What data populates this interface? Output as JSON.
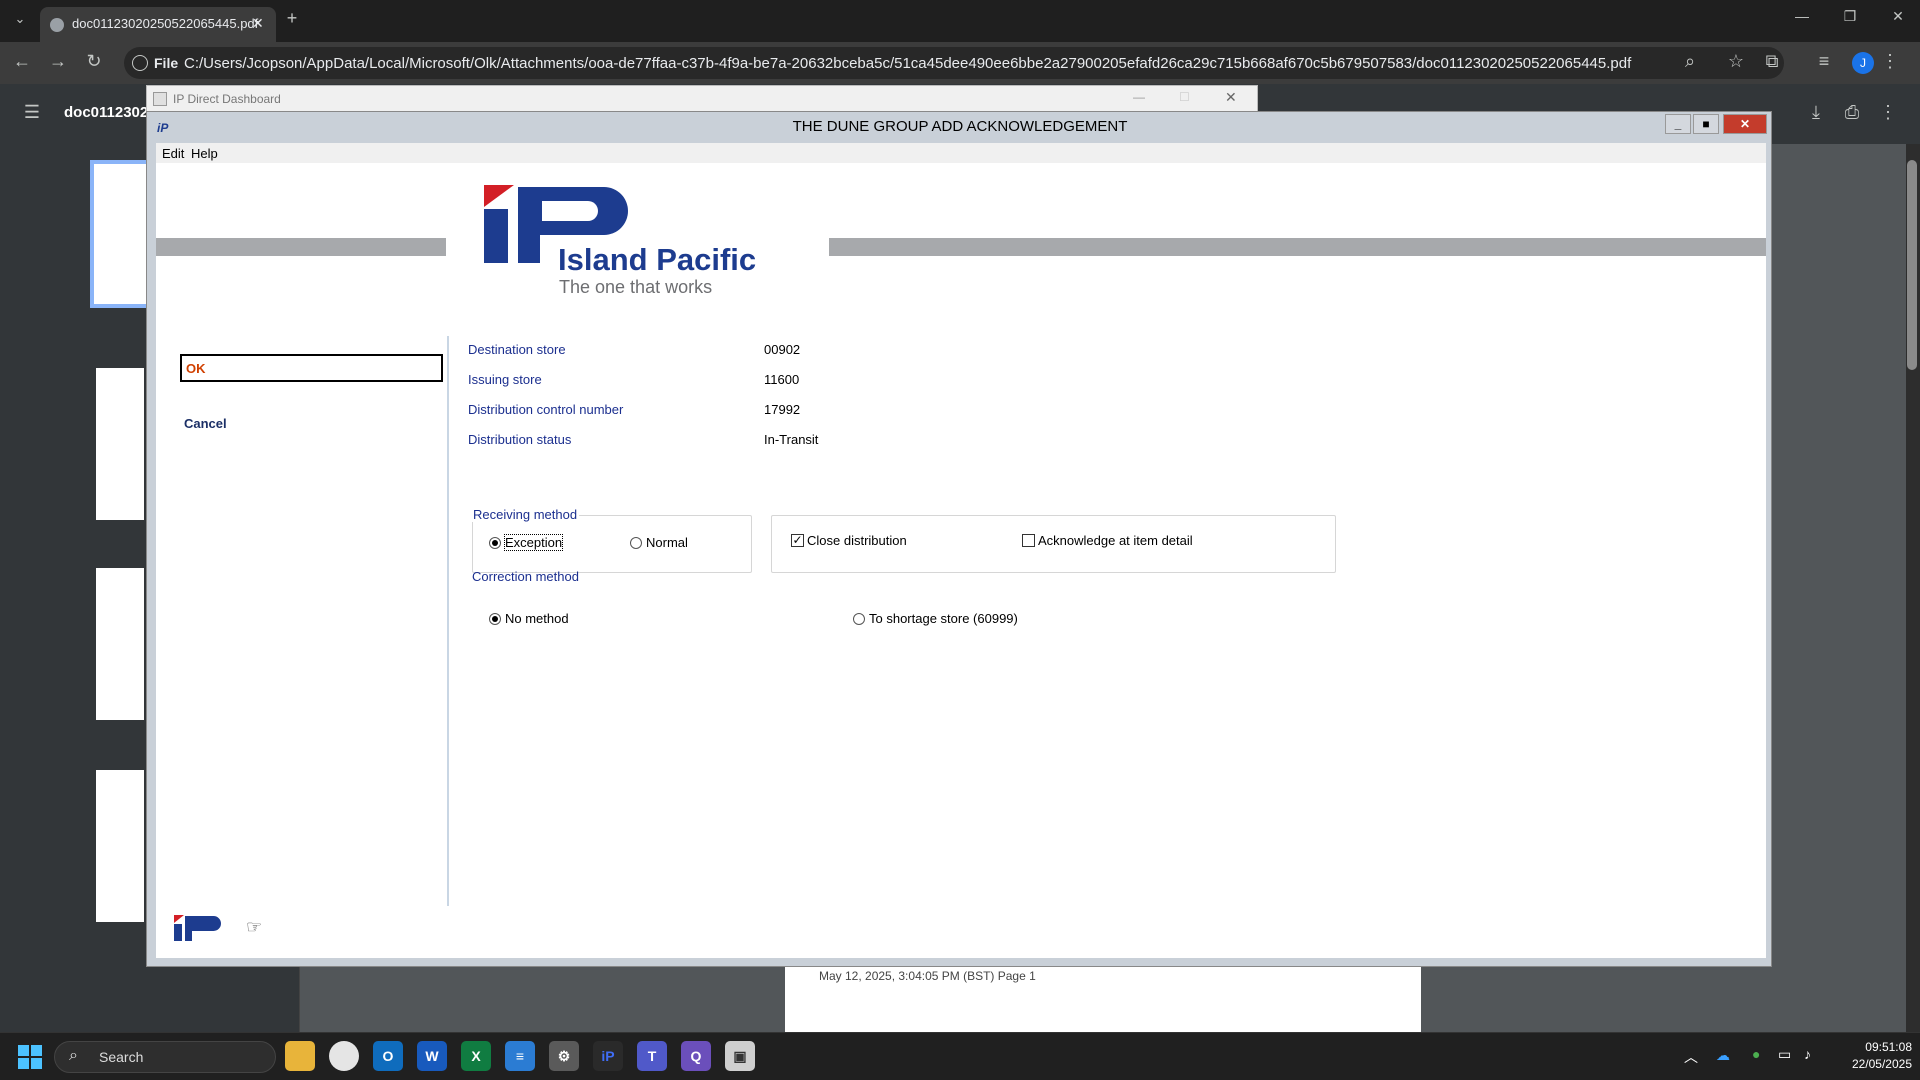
{
  "browser": {
    "tab_title": "doc01123020250522065445.pdf",
    "chip": "File",
    "url": "C:/Users/Jcopson/AppData/Local/Microsoft/Olk/Attachments/ooa-de77ffaa-c37b-4f9a-be7a-20632bceba5c/51ca45dee490ee6bbe2a27900205efafd26ca29c715b668af670c5b679507583/doc01123020250522065445.pdf",
    "profile_initial": "J"
  },
  "pdf": {
    "title": "doc01123020",
    "page_footer": "May 12, 2025, 3:04:05 PM (BST) Page 1"
  },
  "back_window": {
    "title": "IP Direct Dashboard"
  },
  "dialog": {
    "title": "THE DUNE GROUP    ADD ACKNOWLEDGEMENT",
    "menu": [
      "Edit",
      "Help"
    ],
    "logo": {
      "brand": "Island Pacific",
      "tagline": "The one that works",
      "mark": "iP"
    },
    "actions": {
      "ok": "OK",
      "cancel": "Cancel"
    },
    "fields": [
      {
        "label": "Destination store",
        "value": "00902"
      },
      {
        "label": "Issuing store",
        "value": "11600"
      },
      {
        "label": "Distribution control number",
        "value": "17992"
      },
      {
        "label": "Distribution status",
        "value": "In-Transit"
      }
    ],
    "receiving_method": {
      "title": "Receiving method",
      "options": [
        "Exception",
        "Normal"
      ],
      "selected": "Exception"
    },
    "distribution_options": {
      "close_distribution": {
        "label": "Close distribution",
        "checked": true
      },
      "acknowledge_item_detail": {
        "label": "Acknowledge at item detail",
        "checked": false
      }
    },
    "correction_method": {
      "title": "Correction method",
      "options": [
        "No method",
        "To shortage store (60999)"
      ],
      "selected": "No method"
    }
  },
  "taskbar": {
    "search": "Search",
    "time": "09:51:08",
    "date": "22/05/2025"
  }
}
